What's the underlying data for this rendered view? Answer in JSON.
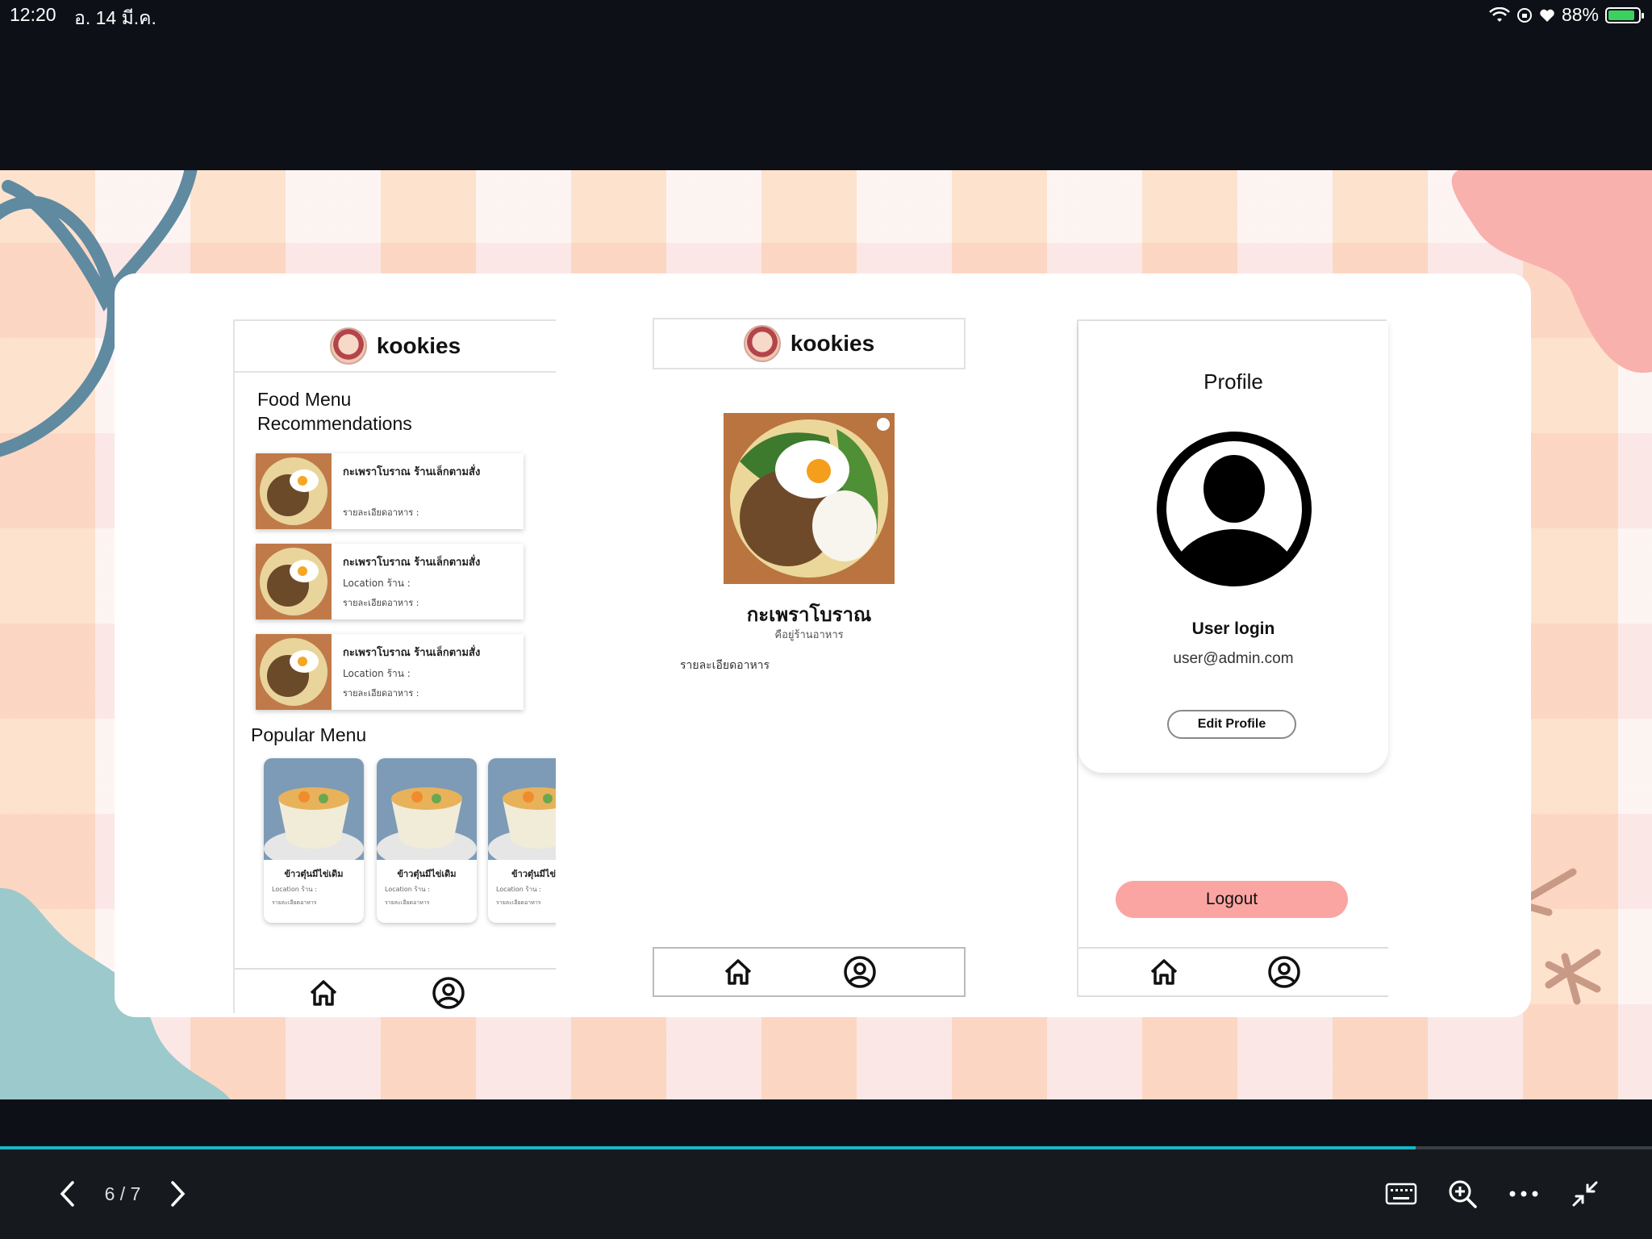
{
  "status_bar": {
    "time": "12:20",
    "date": "อ. 14 มี.ค.",
    "battery": "88%",
    "battery_level": 0.88
  },
  "slide": {
    "screen1": {
      "brand": "kookies",
      "section1_line1": "Food Menu",
      "section1_line2": "Recommendations",
      "recommendations": [
        {
          "name": "กะเพราโบราณ ร้านเล็กตามสั่ง",
          "location": "",
          "detail": "รายละเอียดอาหาร :"
        },
        {
          "name": "กะเพราโบราณ ร้านเล็กตามสั่ง",
          "location": "Location ร้าน :",
          "detail": "รายละเอียดอาหาร :"
        },
        {
          "name": "กะเพราโบราณ ร้านเล็กตามสั่ง",
          "location": "Location ร้าน :",
          "detail": "รายละเอียดอาหาร :"
        }
      ],
      "section2": "Popular Menu",
      "popular": [
        {
          "name": "ข้าวตุ๋นมีไข่เดิม",
          "location": "Location ร้าน :",
          "detail": "รายละเอียดอาหาร"
        },
        {
          "name": "ข้าวตุ๋นมีไข่เดิม",
          "location": "Location ร้าน :",
          "detail": "รายละเอียดอาหาร"
        },
        {
          "name": "ข้าวตุ๋นมีไข่เดิ",
          "location": "Location ร้าน :",
          "detail": "รายละเอียดอาหาร"
        }
      ]
    },
    "screen2": {
      "brand": "kookies",
      "dish_name": "กะเพราโบราณ",
      "shop_location": "คือยู่ร้านอาหาร",
      "detail": "รายละเอียดอาหาร"
    },
    "screen3": {
      "title": "Profile",
      "user_name": "User login",
      "email": "user@admin.com",
      "edit_button": "Edit Profile",
      "logout_button": "Logout"
    }
  },
  "viewer": {
    "page_indicator": "6 / 7",
    "progress": 0.857
  },
  "icons": {
    "wifi": "wifi-icon",
    "orientation": "orientation-lock-icon",
    "heart": "heart-icon",
    "home": "home-icon",
    "profile": "user-circle-icon",
    "keyboard": "keyboard-icon",
    "zoom": "zoom-in-icon",
    "more": "more-icon",
    "collapse": "collapse-icon"
  },
  "colors": {
    "logout": "#fba5a3",
    "progress": "#16b6c9",
    "accent_blue": "#5f8aa0",
    "accent_teal": "#9cc9cc",
    "accent_pink": "#f9b1ae",
    "accent_brown": "#c89a86"
  }
}
